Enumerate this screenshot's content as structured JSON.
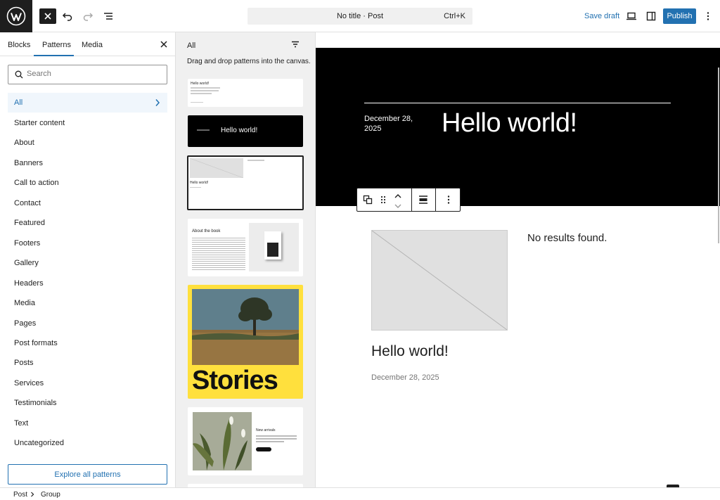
{
  "topbar": {
    "title": "No title · Post",
    "shortcut": "Ctrl+K",
    "save_draft": "Save draft",
    "publish": "Publish"
  },
  "sidebar": {
    "tabs": [
      {
        "label": "Blocks"
      },
      {
        "label": "Patterns"
      },
      {
        "label": "Media"
      }
    ],
    "search_placeholder": "Search",
    "categories": [
      {
        "label": "All"
      },
      {
        "label": "Starter content"
      },
      {
        "label": "About"
      },
      {
        "label": "Banners"
      },
      {
        "label": "Call to action"
      },
      {
        "label": "Contact"
      },
      {
        "label": "Featured"
      },
      {
        "label": "Footers"
      },
      {
        "label": "Gallery"
      },
      {
        "label": "Headers"
      },
      {
        "label": "Media"
      },
      {
        "label": "Pages"
      },
      {
        "label": "Post formats"
      },
      {
        "label": "Posts"
      },
      {
        "label": "Services"
      },
      {
        "label": "Testimonials"
      },
      {
        "label": "Text"
      },
      {
        "label": "Uncategorized"
      }
    ],
    "explore": "Explore all patterns"
  },
  "patterns": {
    "title": "All",
    "help": "Drag and drop patterns into the canvas.",
    "p1_title": "Hello world!",
    "p2_title": "Hello world!",
    "p3_title": "Hello world!",
    "p4_title": "About the book",
    "p5_title": "Stories",
    "p6_title": "New arrivals"
  },
  "canvas": {
    "hero_date": "December 28, 2025",
    "hero_title": "Hello world!",
    "no_results": "No results found.",
    "post_title": "Hello world!",
    "post_date": "December 28, 2025"
  },
  "breadcrumb": {
    "items": [
      {
        "label": "Post"
      },
      {
        "label": "Group"
      }
    ]
  },
  "colors": {
    "accent": "#2271b1",
    "dark": "#1e1e1e",
    "stories_yellow": "#ffe03d"
  }
}
